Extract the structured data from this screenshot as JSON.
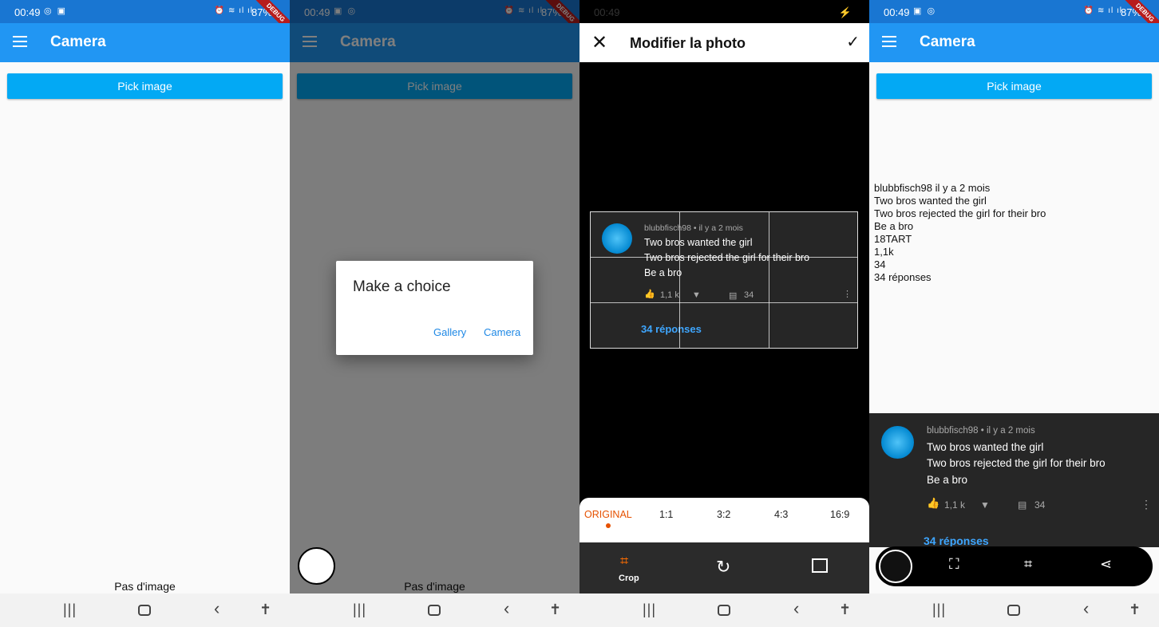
{
  "status": {
    "time": "00:49",
    "battery": "87%",
    "debug": "DEBUG"
  },
  "colors": {
    "appbar": "#2196f3",
    "button": "#03a9f4",
    "accent": "#e65100",
    "link": "#3ea6ff"
  },
  "app": {
    "title": "Camera",
    "pick_label": "Pick image",
    "empty_label": "Pas d'image"
  },
  "dialog": {
    "title": "Make a choice",
    "gallery": "Gallery",
    "camera": "Camera"
  },
  "editor": {
    "title": "Modifier la photo",
    "ratios": [
      "ORIGINAL",
      "1:1",
      "3:2",
      "4:3",
      "16:9"
    ],
    "crop_label": "Crop"
  },
  "comment": {
    "meta": "blubbfisch98 • il y a 2 mois",
    "line1": "Two bros wanted the girl",
    "line2": "Two bros rejected the girl for their bro",
    "line3": "Be a bro",
    "likes": "1,1 k",
    "replies_count": "34",
    "replies_link": "34 réponses"
  },
  "ocr_lines": [
    "blubbfisch98 il y a 2 mois",
    "Two bros wanted the girl",
    "Two bros rejected the girl for their bro",
    "Be a bro",
    "18TART",
    "1,1k",
    "34",
    "34 réponses"
  ],
  "icons": [
    "menu-icon",
    "close-icon",
    "check-icon",
    "crop-icon",
    "rotate-icon",
    "fit-icon",
    "like-icon",
    "dislike-icon",
    "comment-icon",
    "more-icon",
    "share-icon",
    "edit-crop-icon",
    "scan-icon"
  ]
}
